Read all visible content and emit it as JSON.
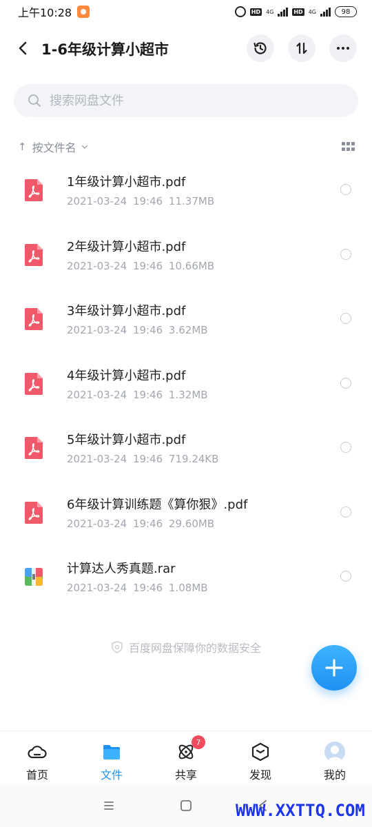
{
  "status_bar": {
    "time": "上午10:28",
    "network_left": "4G",
    "network_right": "4G",
    "hd_left": "HD",
    "hd_right": "HD",
    "battery": "98"
  },
  "header": {
    "title": "1-6年级计算小超市",
    "icons": [
      "back-icon",
      "history-icon",
      "sort-transfer-icon",
      "more-icon"
    ]
  },
  "search": {
    "placeholder": "搜索网盘文件"
  },
  "sort_bar": {
    "arrow": "↑",
    "label": "按文件名"
  },
  "files": [
    {
      "name": "1年级计算小超市.pdf",
      "meta": "2021-03-24 19:46 11.37MB",
      "type": "pdf"
    },
    {
      "name": "2年级计算小超市.pdf",
      "meta": "2021-03-24 19:46 10.66MB",
      "type": "pdf"
    },
    {
      "name": "3年级计算小超市.pdf",
      "meta": "2021-03-24 19:46 3.62MB",
      "type": "pdf"
    },
    {
      "name": "4年级计算小超市.pdf",
      "meta": "2021-03-24 19:46 1.32MB",
      "type": "pdf"
    },
    {
      "name": "5年级计算小超市.pdf",
      "meta": "2021-03-24 19:46 719.24KB",
      "type": "pdf"
    },
    {
      "name": "6年级计算训练题《算你狠》.pdf",
      "meta": "2021-03-24 19:46 29.60MB",
      "type": "pdf"
    },
    {
      "name": "计算达人秀真题.rar",
      "meta": "2021-03-24 19:46 1.08MB",
      "type": "rar"
    }
  ],
  "security_note": "百度网盘保障你的数据安全",
  "bottom_nav": [
    {
      "label": "首页",
      "icon": "home-cloud-icon",
      "active": false
    },
    {
      "label": "文件",
      "icon": "folder-icon",
      "active": true
    },
    {
      "label": "共享",
      "icon": "share-atom-icon",
      "active": false,
      "badge": "7"
    },
    {
      "label": "发现",
      "icon": "discover-cube-icon",
      "active": false
    },
    {
      "label": "我的",
      "icon": "avatar-icon",
      "active": false
    }
  ],
  "watermark": "WWW.XXTTQ.COM",
  "colors": {
    "accent": "#1e92f2",
    "pdf_red": "#f0596a",
    "badge_red": "#f24b5c"
  }
}
